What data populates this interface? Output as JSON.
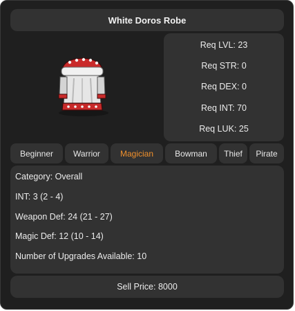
{
  "item": {
    "name": "White Doros Robe",
    "image_icon": "white-robe-icon"
  },
  "requirements": [
    {
      "label": "Req LVL: 23"
    },
    {
      "label": "Req STR: 0"
    },
    {
      "label": "Req DEX: 0"
    },
    {
      "label": "Req INT: 70"
    },
    {
      "label": "Req LUK: 25"
    }
  ],
  "jobs": [
    {
      "label": "Beginner",
      "active": false
    },
    {
      "label": "Warrior",
      "active": false
    },
    {
      "label": "Magician",
      "active": true
    },
    {
      "label": "Bowman",
      "active": false
    },
    {
      "label": "Thief",
      "active": false
    },
    {
      "label": "Pirate",
      "active": false
    }
  ],
  "stats": [
    {
      "text": "Category: Overall"
    },
    {
      "text": "INT: 3 (2 - 4)"
    },
    {
      "text": "Weapon Def: 24 (21 - 27)"
    },
    {
      "text": "Magic Def: 12 (10 - 14)"
    },
    {
      "text": "Number of Upgrades Available: 10"
    }
  ],
  "sell_price": "Sell Price: 8000",
  "colors": {
    "background": "#1f1f1f",
    "panel": "#323232",
    "active_job": "#f0902c",
    "text": "#ececec"
  }
}
